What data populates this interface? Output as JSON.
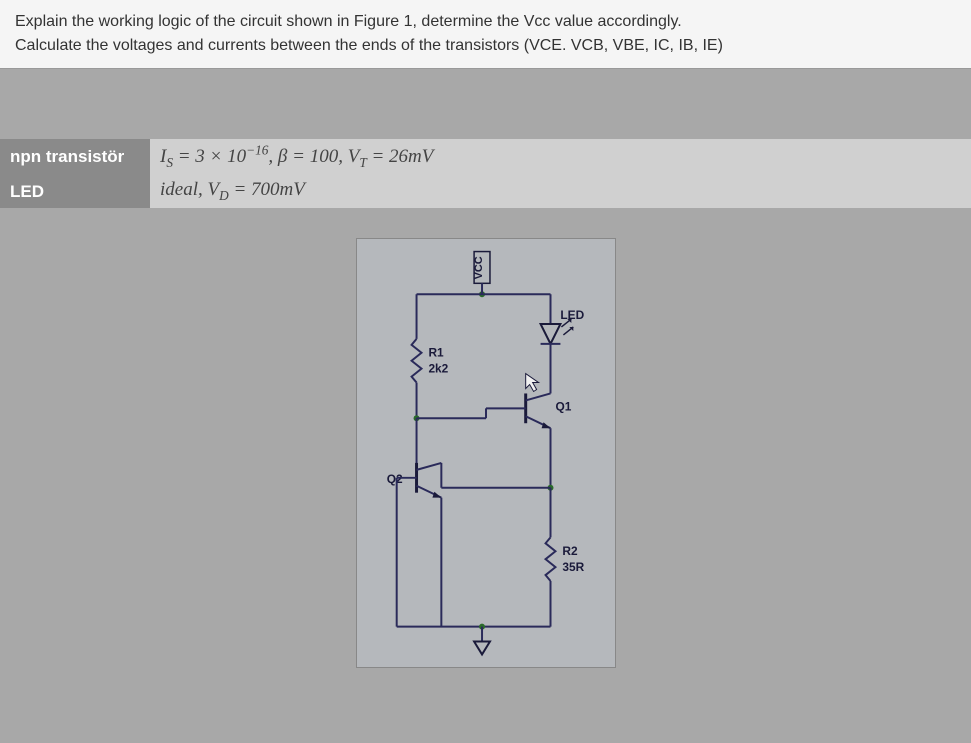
{
  "question": {
    "line1": "Explain the working logic of the circuit shown in Figure 1, determine the Vcc value accordingly.",
    "line2": "Calculate the voltages and currents between the ends of the transistors (VCE. VCB, VBE, IC, IB, IE)"
  },
  "params": {
    "npn_label": "npn transistör",
    "led_label": "LED",
    "npn_values_html": "I<sub>S</sub> = 3 × 10<sup>−16</sup>, β = 100, V<sub>T</sub> = 26mV",
    "led_values_html": "ideal, V<sub>D</sub> = 700mV",
    "npn": {
      "Is": "3 × 10^-16",
      "beta": "100",
      "Vt": "26mV"
    },
    "led": {
      "type": "ideal",
      "Vd": "700mV"
    }
  },
  "circuit": {
    "vcc": "VCC",
    "r1": {
      "name": "R1",
      "value": "2k2"
    },
    "r2": {
      "name": "R2",
      "value": "35R"
    },
    "q1": "Q1",
    "q2": "Q2",
    "led": "LED"
  }
}
